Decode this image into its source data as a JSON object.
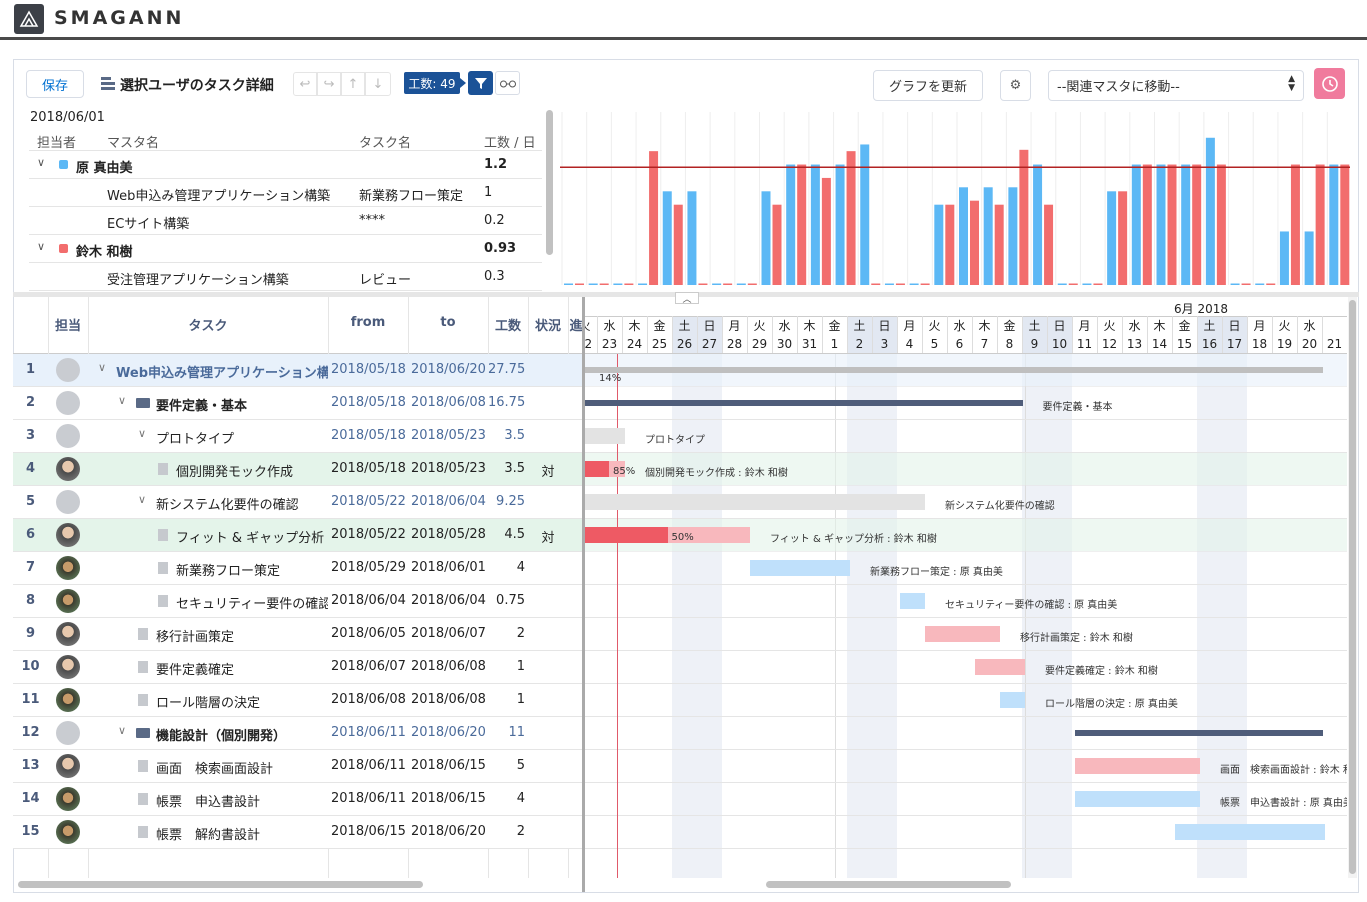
{
  "brand": "SMAGANN",
  "toolbar": {
    "save": "保存",
    "title": "選択ユーザのタスク詳細",
    "workload": "工数: 49",
    "update": "グラフを更新",
    "master_select": "--関連マスタに移動--"
  },
  "summary": {
    "date": "2018/06/01",
    "headers": [
      "担当者",
      "マスタ名",
      "タスク名",
      "工数 / 日"
    ],
    "rows": [
      {
        "kind": "user",
        "name": "原 真由美",
        "value": "1.2",
        "color": "#5cb8f5"
      },
      {
        "kind": "task",
        "master": "Web申込み管理アプリケーション構築",
        "task": "新業務フロー策定",
        "value": "1"
      },
      {
        "kind": "task",
        "master": "ECサイト構築",
        "task": "****",
        "value": "0.2"
      },
      {
        "kind": "user",
        "name": "鈴木 和樹",
        "value": "0.93",
        "color": "#f26d6d"
      },
      {
        "kind": "task",
        "master": "受注管理アプリケーション構築",
        "task": "レビュー",
        "value": "0.3"
      }
    ]
  },
  "chart_data": {
    "type": "bar",
    "series": [
      {
        "name": "原 真由美",
        "color": "#5cb8f5"
      },
      {
        "name": "鈴木 和樹",
        "color": "#f26d6d"
      }
    ],
    "pairs": [
      [
        0,
        0
      ],
      [
        0,
        0
      ],
      [
        0,
        0
      ],
      [
        0,
        1.0
      ],
      [
        0.7,
        0.6
      ],
      [
        0.7,
        0
      ],
      [
        0,
        0
      ],
      [
        0,
        0
      ],
      [
        0.7,
        0.6
      ],
      [
        0.9,
        0.9
      ],
      [
        0.9,
        0.8
      ],
      [
        0.9,
        1.0
      ],
      [
        1.05,
        0
      ],
      [
        0,
        0
      ],
      [
        0,
        0
      ],
      [
        0.6,
        0.6
      ],
      [
        0.73,
        0.63
      ],
      [
        0.73,
        0.6
      ],
      [
        0.73,
        1.01
      ],
      [
        0.9,
        0.6
      ],
      [
        0,
        0
      ],
      [
        0,
        0
      ],
      [
        0.7,
        0.7
      ],
      [
        0.9,
        0.9
      ],
      [
        0.9,
        0.9
      ],
      [
        0.9,
        0.9
      ],
      [
        1.1,
        0.9
      ],
      [
        0,
        0
      ],
      [
        0,
        0
      ],
      [
        0.4,
        0.9
      ],
      [
        0.4,
        0.9
      ],
      [
        0.9,
        0.9
      ]
    ],
    "threshold": 0.88,
    "ylim": [
      0,
      1.3
    ]
  },
  "grid": {
    "headers": {
      "assignee": "担当",
      "task": "タスク",
      "from": "from",
      "to": "to",
      "effort": "工数",
      "status": "状況",
      "progress": "進"
    },
    "month": "6月 2018",
    "weekdays": [
      "火",
      "水",
      "木",
      "金",
      "土",
      "日",
      "月",
      "火",
      "水",
      "木",
      "金",
      "土",
      "日",
      "月",
      "火",
      "水",
      "木",
      "金",
      "土",
      "日",
      "月",
      "火",
      "水",
      "木",
      "金",
      "土",
      "日",
      "月",
      "火",
      "水"
    ],
    "days": [
      "22",
      "23",
      "24",
      "25",
      "26",
      "27",
      "28",
      "29",
      "30",
      "31",
      "1",
      "2",
      "3",
      "4",
      "5",
      "6",
      "7",
      "8",
      "9",
      "10",
      "11",
      "12",
      "13",
      "14",
      "15",
      "16",
      "17",
      "18",
      "19",
      "20",
      "21"
    ],
    "rows": [
      {
        "no": "1",
        "avatar": "blank",
        "indent": 0,
        "type": "group",
        "name": "Web申込み管理アプリケーション構築",
        "from": "2018/05/18",
        "to": "2018/06/20",
        "effort": "27.75",
        "status": "",
        "bg": "#e8f1fb",
        "linkcolor": true
      },
      {
        "no": "2",
        "avatar": "blank",
        "indent": 1,
        "type": "folder",
        "name": "要件定義・基本",
        "from": "2018/05/18",
        "to": "2018/06/08",
        "effort": "16.75",
        "status": "",
        "bg": "#fff",
        "linkcolor": true
      },
      {
        "no": "3",
        "avatar": "blank",
        "indent": 2,
        "type": "sub",
        "name": "プロトタイプ",
        "from": "2018/05/18",
        "to": "2018/05/23",
        "effort": "3.5",
        "status": "",
        "bg": "#fff",
        "linkcolor": true
      },
      {
        "no": "4",
        "avatar": "a",
        "indent": 3,
        "type": "doc",
        "name": "個別開発モック作成",
        "from": "2018/05/18",
        "to": "2018/05/23",
        "effort": "3.5",
        "status": "対",
        "bg": "#e4f4ea",
        "linkcolor": false
      },
      {
        "no": "5",
        "avatar": "blank",
        "indent": 2,
        "type": "sub",
        "name": "新システム化要件の確認",
        "from": "2018/05/22",
        "to": "2018/06/04",
        "effort": "9.25",
        "status": "",
        "bg": "#fff",
        "linkcolor": true
      },
      {
        "no": "6",
        "avatar": "a",
        "indent": 3,
        "type": "doc",
        "name": "フィット & ギャップ分析",
        "from": "2018/05/22",
        "to": "2018/05/28",
        "effort": "4.5",
        "status": "対",
        "bg": "#e4f4ea",
        "linkcolor": false
      },
      {
        "no": "7",
        "avatar": "b",
        "indent": 3,
        "type": "doc",
        "name": "新業務フロー策定",
        "from": "2018/05/29",
        "to": "2018/06/01",
        "effort": "4",
        "status": "",
        "bg": "#fff",
        "linkcolor": false
      },
      {
        "no": "8",
        "avatar": "b",
        "indent": 3,
        "type": "doc",
        "name": "セキュリティー要件の確認",
        "from": "2018/06/04",
        "to": "2018/06/04",
        "effort": "0.75",
        "status": "",
        "bg": "#fff",
        "linkcolor": false
      },
      {
        "no": "9",
        "avatar": "a",
        "indent": 2,
        "type": "doc",
        "name": "移行計画策定",
        "from": "2018/06/05",
        "to": "2018/06/07",
        "effort": "2",
        "status": "",
        "bg": "#fff",
        "linkcolor": false
      },
      {
        "no": "10",
        "avatar": "a",
        "indent": 2,
        "type": "doc",
        "name": "要件定義確定",
        "from": "2018/06/07",
        "to": "2018/06/08",
        "effort": "1",
        "status": "",
        "bg": "#fff",
        "linkcolor": false
      },
      {
        "no": "11",
        "avatar": "b",
        "indent": 2,
        "type": "doc",
        "name": "ロール階層の決定",
        "from": "2018/06/08",
        "to": "2018/06/08",
        "effort": "1",
        "status": "",
        "bg": "#fff",
        "linkcolor": false
      },
      {
        "no": "12",
        "avatar": "blank",
        "indent": 1,
        "type": "folder",
        "name": "機能設計（個別開発）",
        "from": "2018/06/11",
        "to": "2018/06/20",
        "effort": "11",
        "status": "",
        "bg": "#fff",
        "linkcolor": true
      },
      {
        "no": "13",
        "avatar": "a",
        "indent": 2,
        "type": "doc",
        "name": "画面　検索画面設計",
        "from": "2018/06/11",
        "to": "2018/06/15",
        "effort": "5",
        "status": "",
        "bg": "#fff",
        "linkcolor": false
      },
      {
        "no": "14",
        "avatar": "b",
        "indent": 2,
        "type": "doc",
        "name": "帳票　申込書設計",
        "from": "2018/06/11",
        "to": "2018/06/15",
        "effort": "4",
        "status": "",
        "bg": "#fff",
        "linkcolor": false
      },
      {
        "no": "15",
        "avatar": "b",
        "indent": 2,
        "type": "doc",
        "name": "帳票　解約書設計",
        "from": "2018/06/15",
        "to": "2018/06/20",
        "effort": "2",
        "status": "",
        "bg": "#fff",
        "linkcolor": false
      }
    ]
  },
  "gantt": {
    "bars": [
      {
        "row": 0,
        "start": 0,
        "end": 29.5,
        "kind": "summary-gray",
        "label": "",
        "pct": "14%"
      },
      {
        "row": 1,
        "start": 0,
        "end": 17.5,
        "kind": "summary-dark",
        "label": "要件定義・基本",
        "pct": ""
      },
      {
        "row": 2,
        "start": 0,
        "end": 1.6,
        "kind": "gray",
        "label": "プロトタイプ",
        "pct": ""
      },
      {
        "row": 3,
        "start": 0,
        "end": 1.6,
        "kind": "red-progress",
        "progress": 0.6,
        "label": "個別開発モック作成 : 鈴木 和樹",
        "pct": "85%"
      },
      {
        "row": 4,
        "start": 0,
        "end": 13.6,
        "kind": "gray",
        "label": "新システム化要件の確認",
        "pct": ""
      },
      {
        "row": 5,
        "start": 0,
        "end": 6.6,
        "kind": "red-progress",
        "progress": 0.5,
        "label": "フィット & ギャップ分析 : 鈴木 和樹",
        "pct": "50%"
      },
      {
        "row": 6,
        "start": 6.6,
        "end": 10.6,
        "kind": "blue",
        "label": "新業務フロー策定 : 原 真由美",
        "pct": ""
      },
      {
        "row": 7,
        "start": 12.6,
        "end": 13.6,
        "kind": "blue",
        "label": "セキュリティー要件の確認 : 原 真由美",
        "pct": ""
      },
      {
        "row": 8,
        "start": 13.6,
        "end": 16.6,
        "kind": "red",
        "label": "移行計画策定 : 鈴木 和樹",
        "pct": ""
      },
      {
        "row": 9,
        "start": 15.6,
        "end": 17.6,
        "kind": "red",
        "label": "要件定義確定 : 鈴木 和樹",
        "pct": ""
      },
      {
        "row": 10,
        "start": 16.6,
        "end": 17.6,
        "kind": "blue",
        "label": "ロール階層の決定 : 原 真由美",
        "pct": ""
      },
      {
        "row": 11,
        "start": 19.6,
        "end": 29.5,
        "kind": "summary-dark",
        "label": "",
        "pct": ""
      },
      {
        "row": 12,
        "start": 19.6,
        "end": 24.6,
        "kind": "red",
        "label": "画面　検索画面設計 : 鈴木 和樹",
        "pct": ""
      },
      {
        "row": 13,
        "start": 19.6,
        "end": 24.6,
        "kind": "blue",
        "label": "帳票　申込書設計 : 原 真由美",
        "pct": ""
      },
      {
        "row": 14,
        "start": 23.6,
        "end": 29.6,
        "kind": "blue",
        "label": "",
        "pct": ""
      }
    ]
  }
}
